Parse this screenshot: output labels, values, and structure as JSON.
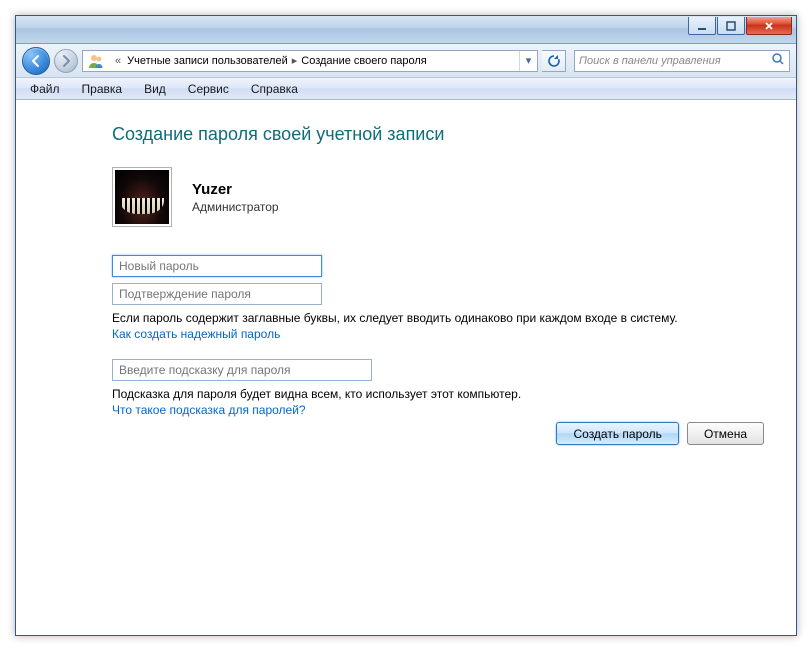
{
  "titlebar": {},
  "breadcrumb": {
    "overflow": "«",
    "item1": "Учетные записи пользователей",
    "item2": "Создание своего пароля"
  },
  "search": {
    "placeholder": "Поиск в панели управления"
  },
  "menu": {
    "file": "Файл",
    "edit": "Правка",
    "view": "Вид",
    "tools": "Сервис",
    "help": "Справка"
  },
  "page": {
    "heading": "Создание пароля своей учетной записи",
    "username": "Yuzer",
    "userrole": "Администратор",
    "new_password_ph": "Новый пароль",
    "confirm_password_ph": "Подтверждение пароля",
    "caps_hint": "Если пароль содержит заглавные буквы, их следует вводить одинаково при каждом входе в систему.",
    "strong_link": "Как создать надежный пароль",
    "hint_ph": "Введите подсказку для пароля",
    "hint_note": "Подсказка для пароля будет видна всем, кто использует этот компьютер.",
    "hint_link": "Что такое подсказка для паролей?",
    "create_btn": "Создать пароль",
    "cancel_btn": "Отмена"
  }
}
